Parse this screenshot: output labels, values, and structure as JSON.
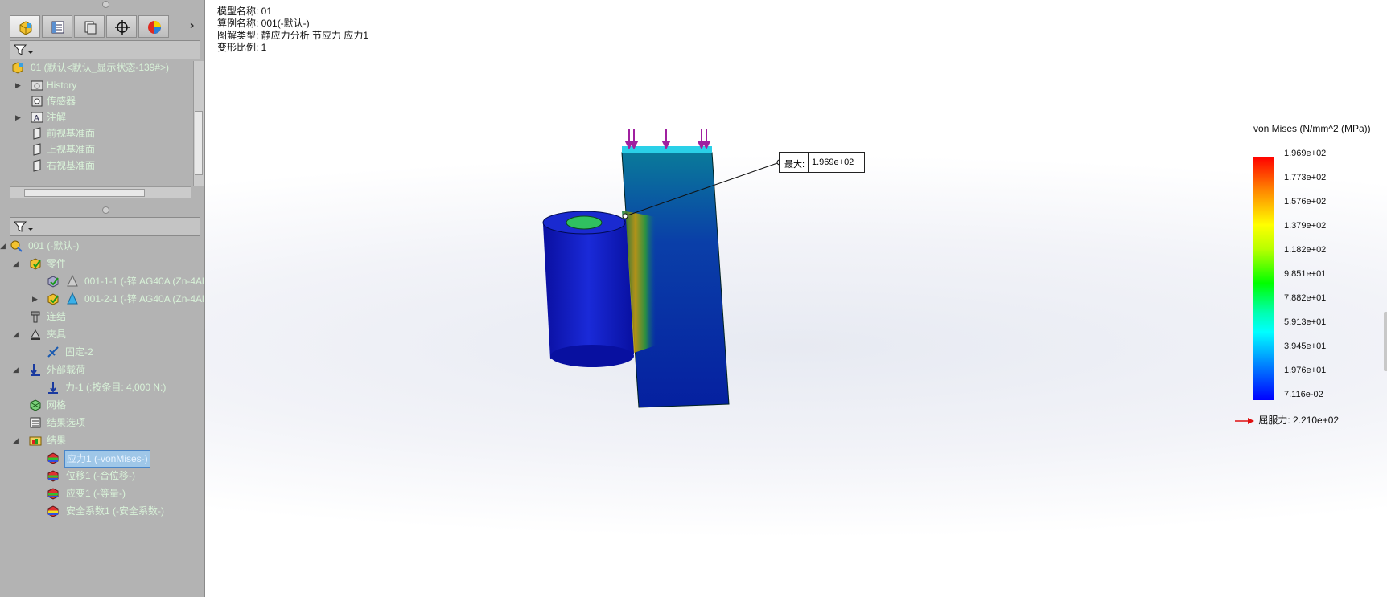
{
  "study_tree_top": {
    "root": "01  (默认<默认_显示状态-139#>)",
    "items": [
      "History",
      "传感器",
      "注解",
      "前视基准面",
      "上视基准面",
      "右视基准面"
    ]
  },
  "sim_tree": {
    "root": "001 (-默认-)",
    "parts": "零件",
    "part1": "001-1-1 (-锌 AG40A (Zn-4Al",
    "part2": "001-2-1 (-锌 AG40A (Zn-4Al",
    "connections": "连结",
    "fixtures": "夹具",
    "fixture1": "固定-2",
    "loads": "外部载荷",
    "load1": "力-1 (:按条目: 4,000 N:)",
    "mesh": "网格",
    "result_options": "结果选项",
    "results": "结果",
    "result_items": [
      "应力1 (-vonMises-)",
      "位移1 (-合位移-)",
      "应变1 (-等量-)",
      "安全系数1 (-安全系数-)"
    ]
  },
  "info": {
    "model": "模型名称: 01",
    "study": "算例名称: 001(-默认-)",
    "plot_type": "图解类型: 静应力分析 节应力 应力1",
    "deform": "变形比例: 1"
  },
  "probe": {
    "key": "最大:",
    "value": "1.969e+02"
  },
  "legend": {
    "title": "von Mises (N/mm^2 (MPa))",
    "ticks": [
      "1.969e+02",
      "1.773e+02",
      "1.576e+02",
      "1.379e+02",
      "1.182e+02",
      "9.851e+01",
      "7.882e+01",
      "5.913e+01",
      "3.945e+01",
      "1.976e+01",
      "7.116e-02"
    ],
    "yield": "屈服力: 2.210e+02"
  },
  "colors": {
    "panel": "#b3b3b3",
    "tree_text": "#d8f2d8",
    "selection": "#9fc7e8"
  }
}
